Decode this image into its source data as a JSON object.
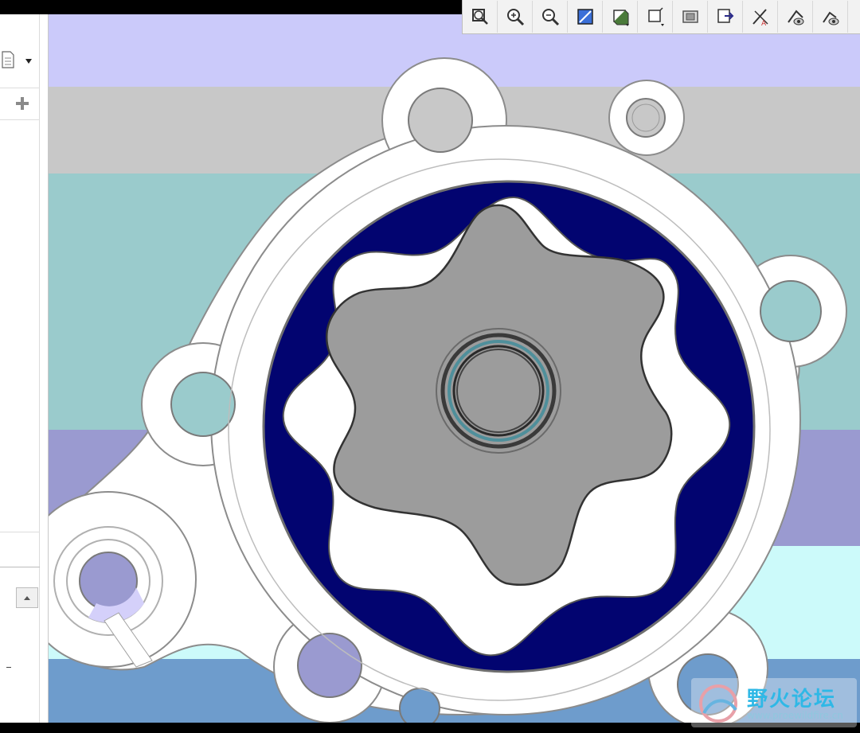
{
  "colors": {
    "band_lavender": "#cbcafa",
    "band_gray": "#c8c8c8",
    "band_teal": "#9acbcc",
    "band_purple": "#9a9ad0",
    "band_cyan": "#ccfafa",
    "band_blue": "#6e9ccc",
    "housing_white": "#ffffff",
    "rotor_navy": "#020470",
    "gear_gray": "#9c9c9c"
  },
  "left_panel": {
    "new_doc_icon": "document-icon",
    "dropdown_icon": "chevron-down-icon",
    "add_icon": "plus-icon",
    "scroll_up_icon": "scroll-up-arrow-icon"
  },
  "toolbar": {
    "buttons": [
      "zoom-fit-icon",
      "zoom-in-icon",
      "zoom-out-icon",
      "repaint-icon",
      "orient-icon",
      "saved-views-icon",
      "display-style-icon",
      "datum-display-icon",
      "axis-display-icon",
      "point-display-icon",
      "annotation-display-icon"
    ]
  },
  "watermark": {
    "text": "野火论坛",
    "url": "www.proewildfire.cn"
  }
}
